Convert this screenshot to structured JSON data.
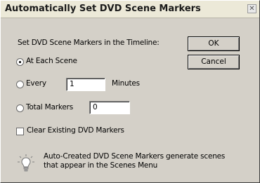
{
  "window": {
    "title": "Automatically Set DVD Scene Markers",
    "close_icon": "close-icon"
  },
  "main": {
    "section_label": "Set DVD Scene Markers in the Timeline:",
    "options": [
      {
        "label": "At Each Scene",
        "selected": true
      },
      {
        "label": "Every",
        "selected": false,
        "value": "1",
        "suffix": "Minutes"
      },
      {
        "label": "Total Markers",
        "selected": false,
        "value": "0"
      }
    ],
    "clear_checkbox": {
      "label": "Clear Existing DVD Markers",
      "checked": false
    },
    "tip": {
      "icon": "lightbulb-icon",
      "line1": "Auto-Created DVD Scene Markers generate scenes",
      "line2": "that appear in the Scenes Menu"
    }
  },
  "buttons": {
    "ok_label": "OK",
    "cancel_label": "Cancel"
  }
}
